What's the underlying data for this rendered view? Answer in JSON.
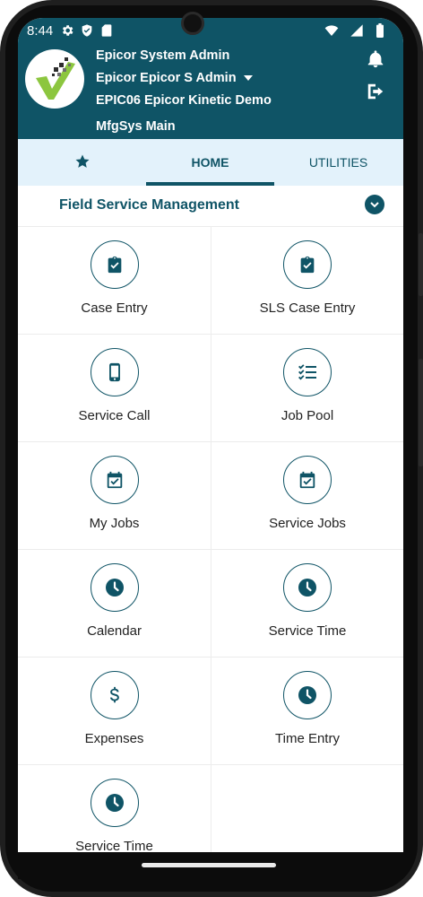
{
  "status": {
    "time": "8:44"
  },
  "header": {
    "user": "Epicor System Admin",
    "company": "Epicor Epicor S Admin",
    "environment": "EPIC06 Epicor Kinetic Demo",
    "site": "MfgSys Main"
  },
  "tabs": [
    {
      "label": "",
      "icon": "star-icon"
    },
    {
      "label": "HOME"
    },
    {
      "label": "UTILITIES"
    }
  ],
  "section": {
    "title": "Field Service Management"
  },
  "tiles": [
    {
      "label": "Case Entry",
      "icon": "clipboard-check-icon"
    },
    {
      "label": "SLS Case Entry",
      "icon": "clipboard-check-icon"
    },
    {
      "label": "Service Call",
      "icon": "phone-icon"
    },
    {
      "label": "Job Pool",
      "icon": "checklist-icon"
    },
    {
      "label": "My Jobs",
      "icon": "calendar-check-icon"
    },
    {
      "label": "Service Jobs",
      "icon": "calendar-check-icon"
    },
    {
      "label": "Calendar",
      "icon": "clock-icon"
    },
    {
      "label": "Service Time",
      "icon": "clock-icon"
    },
    {
      "label": "Expenses",
      "icon": "dollar-icon"
    },
    {
      "label": "Time Entry",
      "icon": "clock-icon"
    },
    {
      "label": "Service Time",
      "icon": "clock-icon"
    }
  ],
  "colors": {
    "brand": "#0f5466",
    "tab_bg": "#e3f2fb",
    "logo_green": "#8cc63f"
  }
}
